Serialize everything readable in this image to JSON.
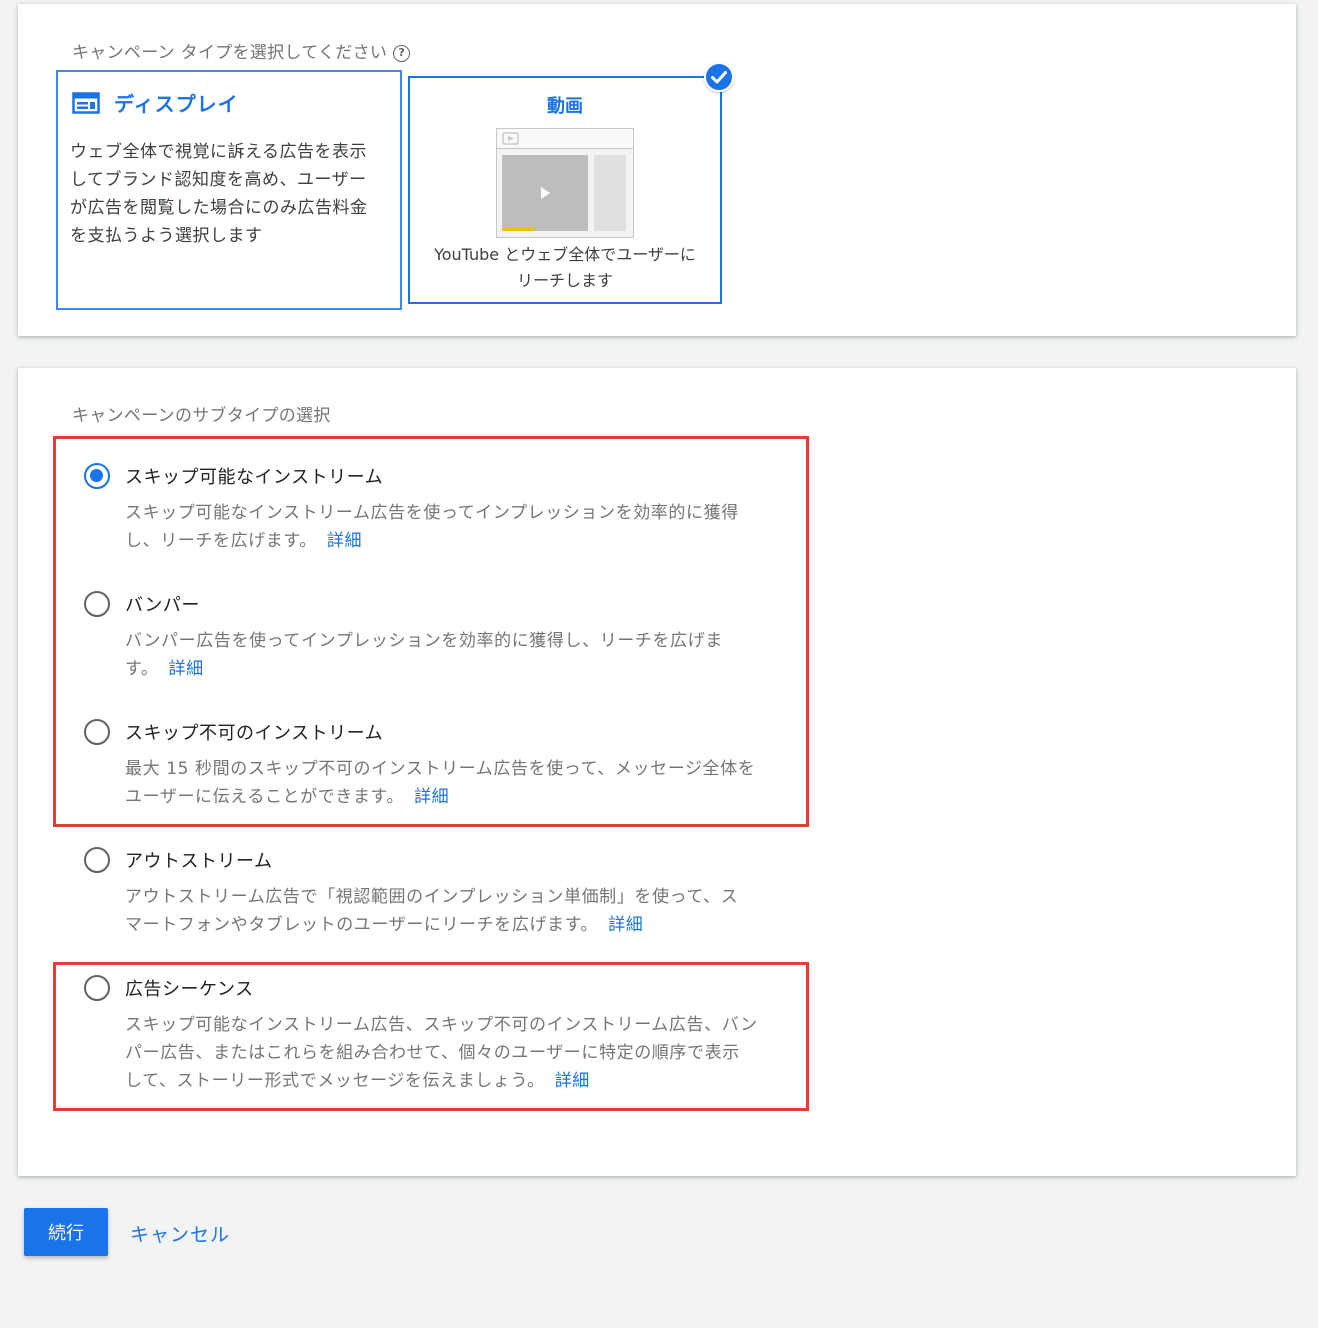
{
  "campaign_type": {
    "title": "キャンペーン タイプを選択してください",
    "help_icon": "help-circle-icon",
    "cards": [
      {
        "title": "ディスプレイ",
        "icon": "display-layout-icon",
        "description_lines": [
          "ウェブ全体で視覚に訴える広告を表示",
          "してブランド認知度を高め、ユーザー",
          "が広告を閲覧した場合にのみ広告料金",
          "を支払うよう選択します"
        ]
      },
      {
        "title": "動画",
        "icon": "video-player-illustration",
        "selected": true,
        "description_lines": [
          "YouTube とウェブ全体でユーザーに",
          "リーチします"
        ]
      }
    ]
  },
  "subtype": {
    "title": "キャンペーンのサブタイプの選択",
    "learn_more": "詳細",
    "options": [
      {
        "title": "スキップ可能なインストリーム",
        "checked": true,
        "description_lines": [
          "スキップ可能なインストリーム広告を使ってインプレッションを効率的に獲得",
          "し、リーチを広げます。"
        ]
      },
      {
        "title": "バンパー",
        "checked": false,
        "description_lines": [
          "バンパー広告を使ってインプレッションを効率的に獲得し、リーチを広げま",
          "す。"
        ]
      },
      {
        "title": "スキップ不可のインストリーム",
        "checked": false,
        "description_lines": [
          "最大 15 秒間のスキップ不可のインストリーム広告を使って、メッセージ全体を",
          "ユーザーに伝えることができます。"
        ]
      },
      {
        "title": "アウトストリーム",
        "checked": false,
        "description_lines": [
          "アウトストリーム広告で「視認範囲のインプレッション単価制」を使って、ス",
          "マートフォンやタブレットのユーザーにリーチを広げます。"
        ]
      },
      {
        "title": "広告シーケンス",
        "checked": false,
        "description_lines": [
          "スキップ可能なインストリーム広告、スキップ不可のインストリーム広告、バン",
          "パー広告、またはこれらを組み合わせて、個々のユーザーに特定の順序で表示",
          "して、ストーリー形式でメッセージを伝えましょう。"
        ]
      }
    ]
  },
  "footer": {
    "continue_label": "続行",
    "cancel_label": "キャンセル"
  },
  "colors": {
    "accent": "#1a73e8",
    "highlight": "#e0412f",
    "background": "#f1f3f4"
  }
}
